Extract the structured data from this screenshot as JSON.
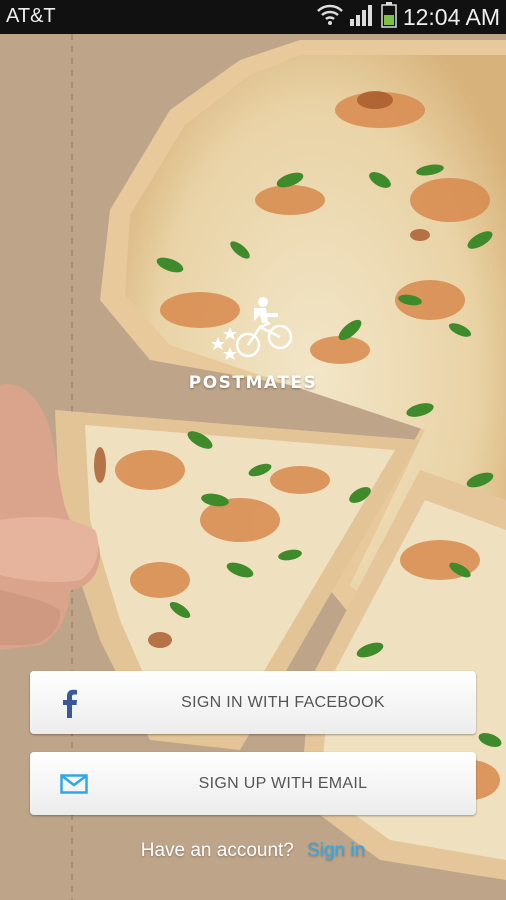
{
  "status_bar": {
    "carrier": "AT&T",
    "time": "12:04 AM",
    "icons": [
      "wifi-icon",
      "signal-icon",
      "battery-icon"
    ]
  },
  "brand": {
    "name": "POSTMATES",
    "logo_icon": "courier-on-bicycle-icon"
  },
  "buttons": {
    "facebook": {
      "label": "SIGN IN WITH FACEBOOK",
      "icon": "facebook-icon",
      "icon_color": "#3b5998"
    },
    "email": {
      "label": "SIGN UP WITH EMAIL",
      "icon": "envelope-icon",
      "icon_color": "#2fa8e8"
    }
  },
  "account_prompt": {
    "text": "Have an account?",
    "link": "Sign in",
    "link_color": "#2fa8e8"
  },
  "background": {
    "image": "pizza-on-cardboard"
  }
}
